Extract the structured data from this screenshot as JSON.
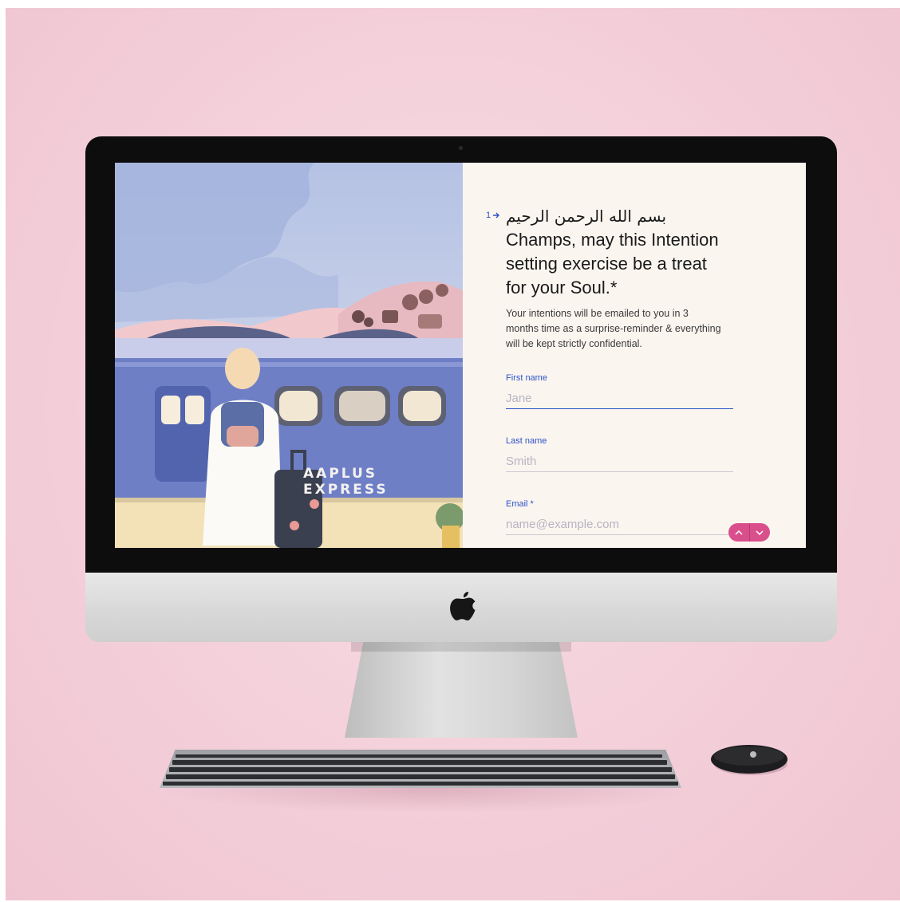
{
  "question": {
    "number": "1",
    "arabic_line": "بسم الله الرحمن الرحيم",
    "title": "Champs, may this Intention setting exercise be a treat for your Soul.*",
    "description": "Your intentions will be emailed to you in 3 months time as a surprise-reminder & everything will be kept strictly confidential."
  },
  "fields": {
    "first_name": {
      "label": "First name",
      "placeholder": "Jane"
    },
    "last_name": {
      "label": "Last name",
      "placeholder": "Smith"
    },
    "email": {
      "label": "Email *",
      "placeholder": "name@example.com"
    }
  },
  "illustration": {
    "train_text": "AAPLUS EXPRESS"
  },
  "colors": {
    "accent": "#2b53c9",
    "nav_button": "#d94f8c",
    "background": "#f2ccd7",
    "form_background": "#fbf5ef"
  },
  "icons": {
    "number_arrow": "arrow-right-icon",
    "nav_up": "chevron-up-icon",
    "nav_down": "chevron-down-icon",
    "brand": "apple-logo-icon"
  }
}
